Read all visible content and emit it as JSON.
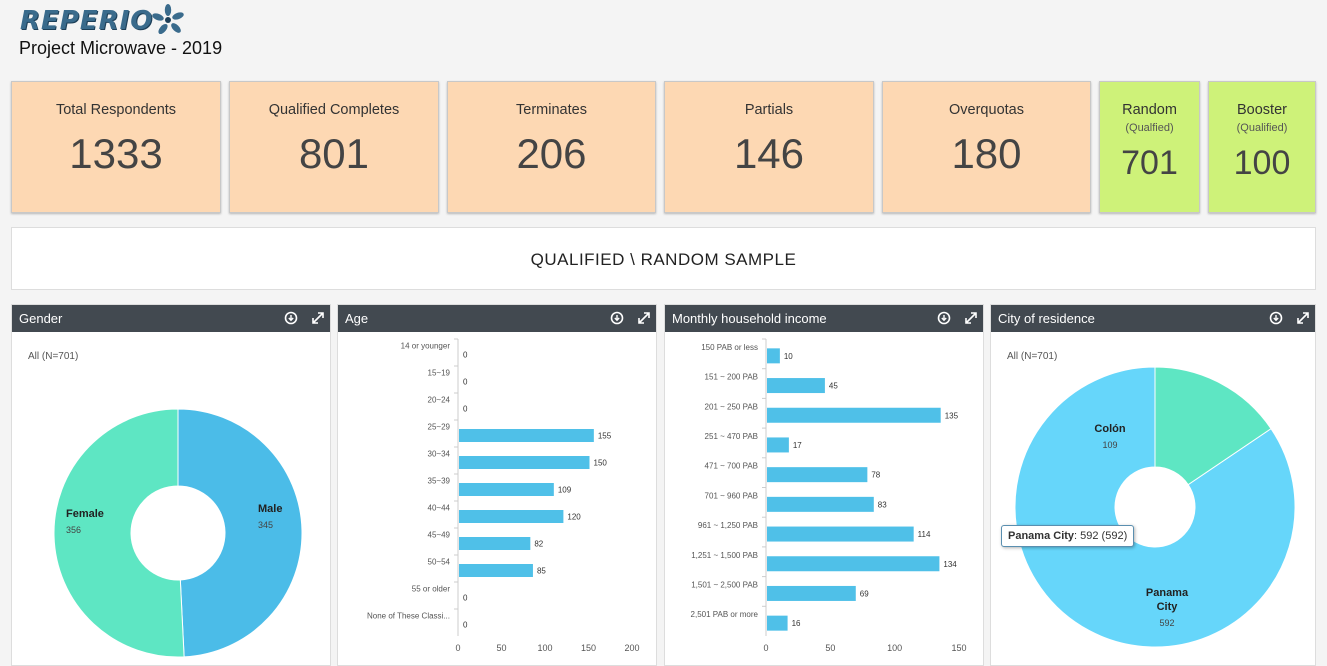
{
  "logo": {
    "text": "REPERIO"
  },
  "project_title": "Project Microwave - 2019",
  "kpis": [
    {
      "label": "Total Respondents",
      "value": "1333"
    },
    {
      "label": "Qualified Completes",
      "value": "801"
    },
    {
      "label": "Terminates",
      "value": "206"
    },
    {
      "label": "Partials",
      "value": "146"
    },
    {
      "label": "Overquotas",
      "value": "180"
    },
    {
      "label": "Random",
      "sub": "(Qualfied)",
      "value": "701"
    },
    {
      "label": "Booster",
      "sub": "(Qualified)",
      "value": "100"
    }
  ],
  "colors": {
    "kpi_orange": "#fdd8b3",
    "kpi_green": "#cef279",
    "header": "#424950",
    "bar": "#4fc0e8",
    "teal": "#5ee6c3"
  },
  "banner": "QUALIFIED \\ RANDOM SAMPLE",
  "panels": [
    {
      "title": "Gender",
      "icons": [
        "download-icon",
        "expand-icon"
      ]
    },
    {
      "title": "Age",
      "icons": [
        "download-icon",
        "expand-icon"
      ]
    },
    {
      "title": "Monthly household income",
      "icons": [
        "download-icon",
        "expand-icon"
      ]
    },
    {
      "title": "City of residence",
      "icons": [
        "download-icon",
        "expand-icon"
      ]
    }
  ],
  "chart_data": [
    {
      "type": "pie",
      "title": "Gender",
      "subtitle": "All (N=701)",
      "categories": [
        "Male",
        "Female"
      ],
      "values": [
        345,
        356
      ],
      "colors": [
        "#4bbce8",
        "#5ee6c3"
      ]
    },
    {
      "type": "bar",
      "orientation": "horizontal",
      "title": "Age",
      "categories": [
        "14 or younger",
        "15~19",
        "20~24",
        "25~29",
        "30~34",
        "35~39",
        "40~44",
        "45~49",
        "50~54",
        "55 or older",
        "None of These Classi..."
      ],
      "values": [
        0,
        0,
        0,
        155,
        150,
        109,
        120,
        82,
        85,
        0,
        0
      ],
      "xlim": [
        0,
        200
      ],
      "xticks": [
        "0",
        "50",
        "100",
        "150",
        "200"
      ]
    },
    {
      "type": "bar",
      "orientation": "horizontal",
      "title": "Monthly household income",
      "categories": [
        "150 PAB or less",
        "151 ~ 200 PAB",
        "201 ~ 250 PAB",
        "251 ~ 470 PAB",
        "471 ~ 700 PAB",
        "701 ~ 960 PAB",
        "961 ~ 1,250 PAB",
        "1,251 ~ 1,500 PAB",
        "1,501 ~ 2,500 PAB",
        "2,501 PAB or more"
      ],
      "values": [
        10,
        45,
        135,
        17,
        78,
        83,
        114,
        134,
        69,
        16
      ],
      "xlim": [
        0,
        150
      ],
      "xticks": [
        "0",
        "50",
        "100",
        "150"
      ]
    },
    {
      "type": "pie",
      "title": "City of residence",
      "subtitle": "All (N=701)",
      "categories": [
        "Panama City",
        "Colón"
      ],
      "label_lines": [
        [
          "Panama",
          "City"
        ],
        [
          "Colón"
        ]
      ],
      "values": [
        592,
        109
      ],
      "colors": [
        "#66d6fa",
        "#5ee6c3"
      ],
      "tooltip": {
        "name": "Panama City",
        "text": ": 592 (592)"
      }
    }
  ]
}
